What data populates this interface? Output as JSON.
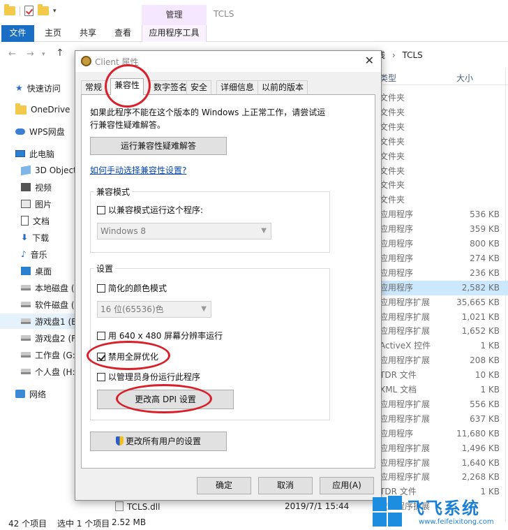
{
  "explorer": {
    "window_title": "TCLS",
    "context_tab": "管理",
    "ribbon_tabs": [
      "文件",
      "主页",
      "共享",
      "查看"
    ],
    "context_tool": "应用程序工具",
    "breadcrumb_prefix": "线",
    "breadcrumb_sep": "›",
    "breadcrumb_current": "TCLS",
    "nav_back": "←",
    "nav_forward": "→",
    "nav_up": "↑",
    "nav_items": [
      {
        "label": "快速访问",
        "icon": "pin-icon"
      },
      {
        "label": "OneDrive",
        "icon": "folder-icon"
      },
      {
        "label": "WPS网盘",
        "icon": "cloud-icon"
      },
      {
        "label": "此电脑",
        "icon": "computer-icon"
      },
      {
        "label": "3D Objects",
        "icon": "cube-icon"
      },
      {
        "label": "视频",
        "icon": "video-icon"
      },
      {
        "label": "图片",
        "icon": "picture-icon"
      },
      {
        "label": "文档",
        "icon": "document-icon"
      },
      {
        "label": "下载",
        "icon": "download-icon"
      },
      {
        "label": "音乐",
        "icon": "music-icon"
      },
      {
        "label": "桌面",
        "icon": "desktop-icon"
      },
      {
        "label": "本地磁盘 (C",
        "icon": "drive-icon"
      },
      {
        "label": "软件磁盘 (D",
        "icon": "drive-icon"
      },
      {
        "label": "游戏盘1 (E:",
        "icon": "drive-icon"
      },
      {
        "label": "游戏盘2 (F:",
        "icon": "drive-icon"
      },
      {
        "label": "工作盘 (G:)",
        "icon": "drive-icon"
      },
      {
        "label": "个人盘 (H:)",
        "icon": "drive-icon"
      },
      {
        "label": "网络",
        "icon": "network-icon"
      }
    ],
    "columns": {
      "type": "类型",
      "size": "大小"
    },
    "rows": [
      {
        "type": "文件夹",
        "size": ""
      },
      {
        "type": "文件夹",
        "size": ""
      },
      {
        "type": "文件夹",
        "size": ""
      },
      {
        "type": "文件夹",
        "size": ""
      },
      {
        "type": "文件夹",
        "size": ""
      },
      {
        "type": "文件夹",
        "size": ""
      },
      {
        "type": "文件夹",
        "size": ""
      },
      {
        "type": "文件夹",
        "size": ""
      },
      {
        "type": "应用程序",
        "size": "536 KB"
      },
      {
        "type": "应用程序",
        "size": "359 KB"
      },
      {
        "type": "应用程序",
        "size": "800 KB"
      },
      {
        "type": "应用程序",
        "size": "274 KB"
      },
      {
        "type": "应用程序",
        "size": "236 KB"
      },
      {
        "type": "应用程序",
        "size": "2,582 KB"
      },
      {
        "type": "应用程序扩展",
        "size": "35,665 KB"
      },
      {
        "type": "应用程序扩展",
        "size": "1,021 KB"
      },
      {
        "type": "应用程序扩展",
        "size": "1,652 KB"
      },
      {
        "type": "ActiveX 控件",
        "size": "1 KB"
      },
      {
        "type": "应用程序扩展",
        "size": "208 KB"
      },
      {
        "type": "TDR 文件",
        "size": "10 KB"
      },
      {
        "type": "XML 文档",
        "size": "1 KB"
      },
      {
        "type": "应用程序扩展",
        "size": "556 KB"
      },
      {
        "type": "应用程序扩展",
        "size": "637 KB"
      },
      {
        "type": "应用程序",
        "size": "11,680 KB"
      },
      {
        "type": "应用程序扩展",
        "size": "1,496 KB"
      },
      {
        "type": "应用程序扩展",
        "size": "1,640 KB"
      },
      {
        "type": "应用程序扩展",
        "size": "2,268 KB"
      },
      {
        "type": "TDR 文件",
        "size": "1 KB"
      },
      {
        "type": "应用程序扩展",
        "size": ""
      }
    ],
    "dll_name": "TCLS.dll",
    "dll_date": "2019/7/1 15:44",
    "status_count": "42 个项目",
    "status_selected": "选中 1 个项目",
    "status_size": "2.52 MB"
  },
  "dialog": {
    "title": "Client 属性",
    "close": "✕",
    "tabs": [
      "常规",
      "兼容性",
      "数字签名",
      "安全",
      "详细信息",
      "以前的版本"
    ],
    "intro": "如果此程序不能在这个版本的 Windows 上正常工作，请尝试运行兼容性疑难解答。",
    "troubleshoot_button": "运行兼容性疑难解答",
    "manual_link": "如何手动选择兼容性设置?",
    "compat_group": "兼容模式",
    "compat_checkbox": "以兼容模式运行这个程序:",
    "compat_os": "Windows 8",
    "settings_group": "设置",
    "reduced_color": "简化的颜色模式",
    "color_option": "16 位(65536)色",
    "res_640": "用 640 x 480 屏幕分辨率运行",
    "disable_fullscreen": "禁用全屏优化",
    "run_admin": "以管理员身份运行此程序",
    "dpi_button": "更改高 DPI 设置",
    "all_users_button": "更改所有用户的设置",
    "ok": "确定",
    "cancel": "取消",
    "apply": "应用(A)"
  },
  "watermark": {
    "brand": "飞飞系统",
    "url": "www.feifeixitong.com"
  },
  "colors": {
    "accent": "#1a6fc4",
    "annotation_red": "#d9202a",
    "selection": "#cce8ff"
  }
}
